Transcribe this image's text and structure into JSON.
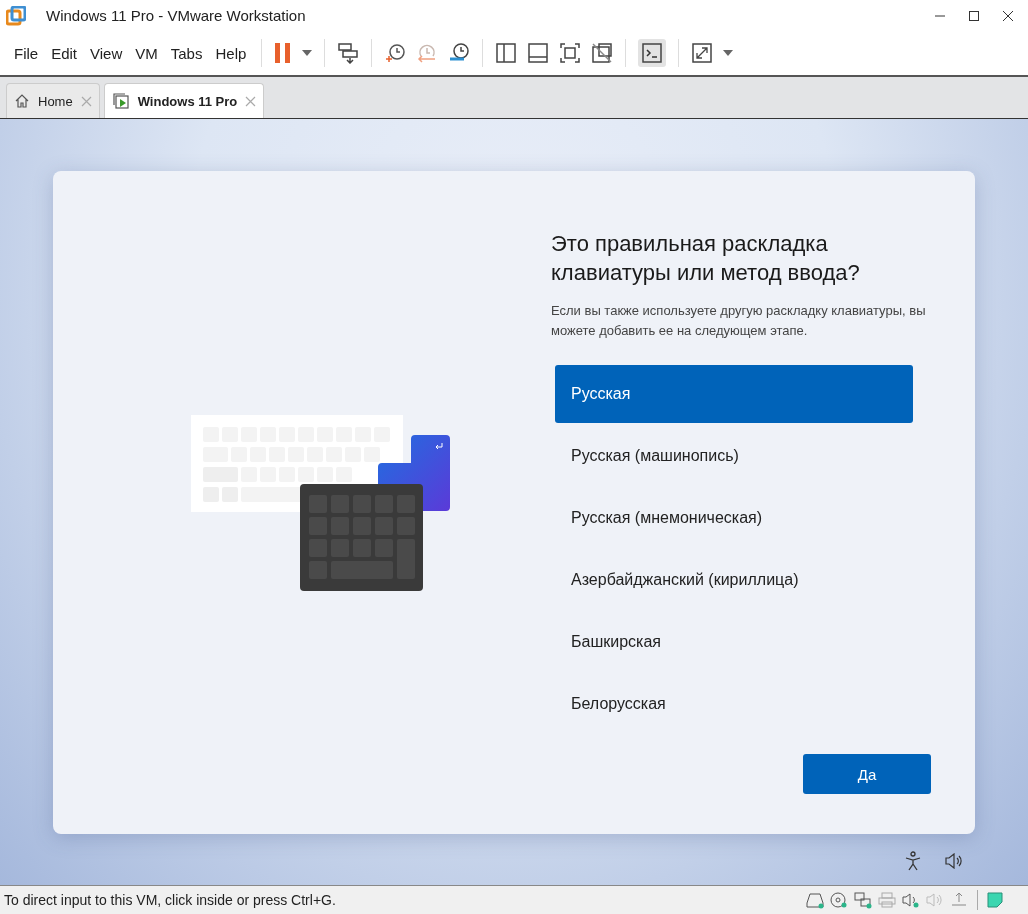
{
  "window": {
    "title": "Windows 11 Pro - VMware Workstation"
  },
  "menu": [
    "File",
    "Edit",
    "View",
    "VM",
    "Tabs",
    "Help"
  ],
  "tabs": [
    {
      "label": "Home",
      "kind": "home",
      "selected": false
    },
    {
      "label": "Windows 11 Pro",
      "kind": "vm",
      "selected": true
    }
  ],
  "setup": {
    "heading": "Это правильная раскладка клавиатуры или метод ввода?",
    "description": "Если вы также используете другую раскладку клавиатуры, вы можете добавить ее на следующем этапе.",
    "layouts": [
      {
        "label": "Русская",
        "selected": true
      },
      {
        "label": "Русская (машинопись)",
        "selected": false
      },
      {
        "label": "Русская (мнемоническая)",
        "selected": false
      },
      {
        "label": "Азербайджанский (кириллица)",
        "selected": false
      },
      {
        "label": "Башкирская",
        "selected": false
      },
      {
        "label": "Белорусская",
        "selected": false
      }
    ],
    "confirm_button": "Да"
  },
  "status_bar": {
    "message": "To direct input to this VM, click inside or press Ctrl+G."
  }
}
